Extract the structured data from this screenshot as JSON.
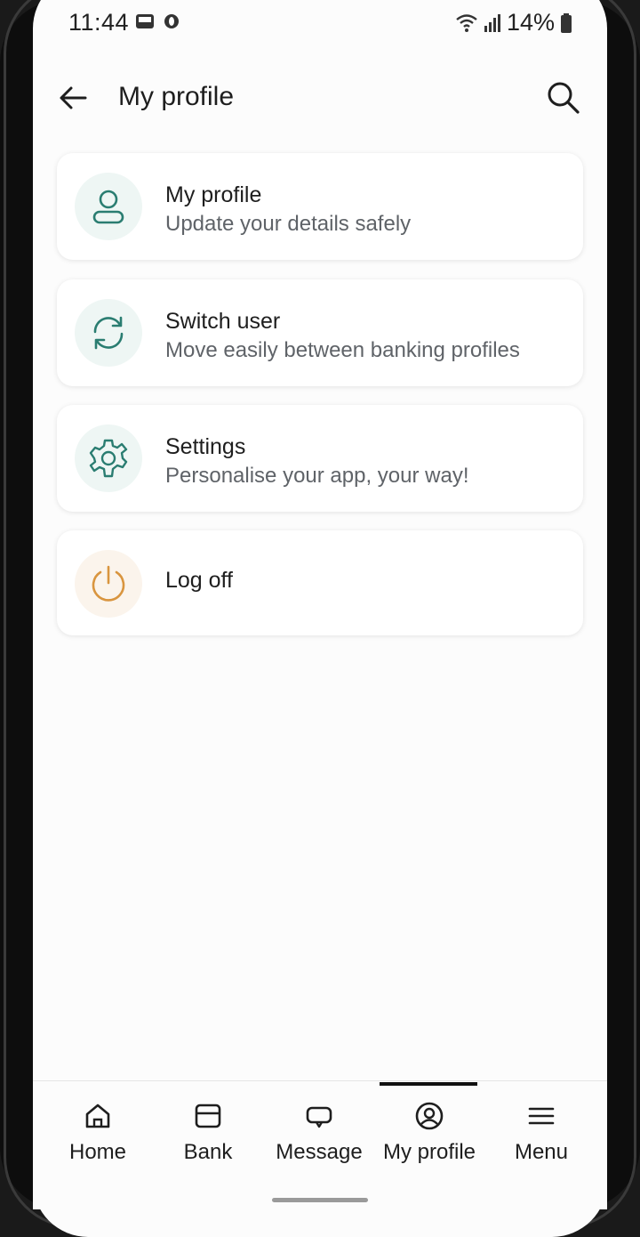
{
  "status_bar": {
    "time": "11:44",
    "battery": "14%",
    "icons": [
      "gallery-icon",
      "notification-dot-icon",
      "wifi-icon",
      "signal-icon",
      "battery-icon"
    ]
  },
  "header": {
    "title": "My profile",
    "back_icon": "arrow-left-icon",
    "search_icon": "search-icon"
  },
  "menu_items": [
    {
      "title": "My profile",
      "subtitle": "Update your details safely",
      "icon": "user-icon"
    },
    {
      "title": "Switch user",
      "subtitle": "Move easily between banking profiles",
      "icon": "switch-icon"
    },
    {
      "title": "Settings",
      "subtitle": "Personalise your app, your way!",
      "icon": "gear-icon"
    },
    {
      "title": "Log off",
      "subtitle": "",
      "icon": "power-icon"
    }
  ],
  "bottom_nav": {
    "items": [
      {
        "label": "Home",
        "icon": "home-icon"
      },
      {
        "label": "Bank",
        "icon": "card-icon"
      },
      {
        "label": "Message",
        "icon": "message-icon"
      },
      {
        "label": "My profile",
        "icon": "profile-icon"
      },
      {
        "label": "Menu",
        "icon": "hamburger-icon"
      }
    ],
    "active": "My profile"
  },
  "colors": {
    "accent": "#2a7d71",
    "warning": "#d9953f",
    "icon_bg": "#eef6f4",
    "warning_bg": "#fbf4ec"
  }
}
